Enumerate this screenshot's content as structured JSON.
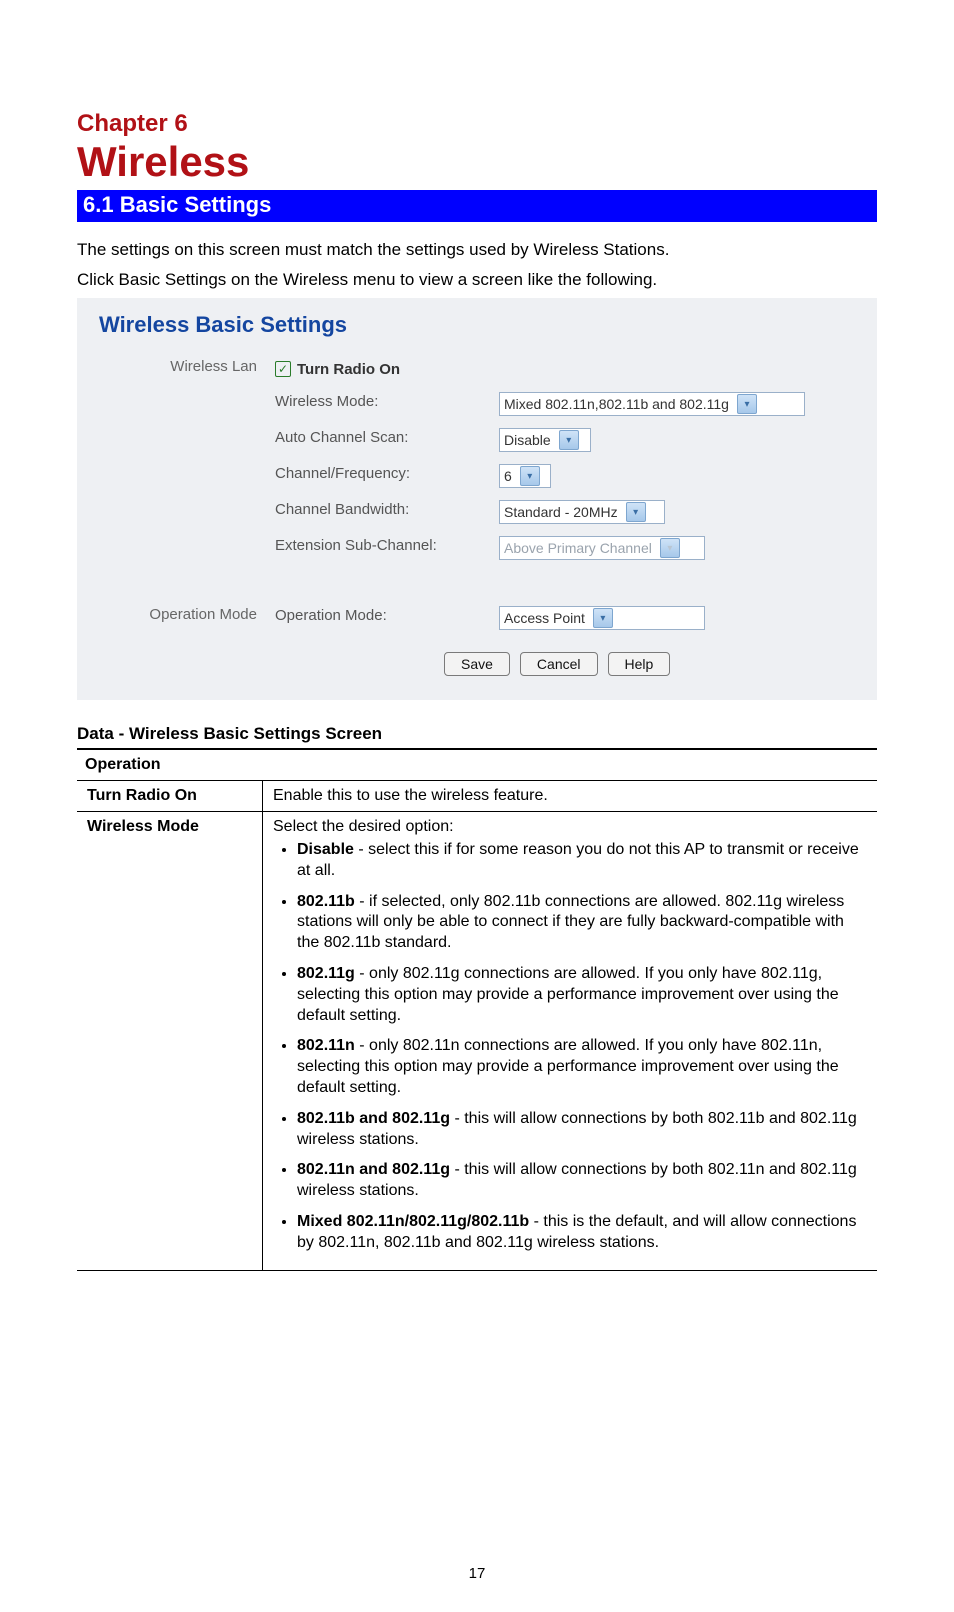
{
  "chapter_label": "Chapter 6",
  "chapter_title": "Wireless",
  "section_heading": "6.1 Basic Settings",
  "intro": {
    "line1": "The settings on this screen must match the settings used by Wireless Stations.",
    "line2": "Click Basic Settings on the Wireless menu to view a screen like the following."
  },
  "panel": {
    "title": "Wireless Basic Settings",
    "group1_label": "Wireless Lan",
    "turn_radio_on_label": "Turn Radio On",
    "turn_radio_on_checked": true,
    "fields": {
      "wireless_mode": {
        "label": "Wireless Mode:",
        "value": "Mixed 802.11n,802.11b and 802.11g"
      },
      "auto_channel_scan": {
        "label": "Auto Channel Scan:",
        "value": "Disable"
      },
      "channel_frequency": {
        "label": "Channel/Frequency:",
        "value": "6"
      },
      "channel_bandwidth": {
        "label": "Channel Bandwidth:",
        "value": "Standard - 20MHz"
      },
      "extension_sub_channel": {
        "label": "Extension Sub-Channel:",
        "value": "Above Primary Channel",
        "disabled": true
      }
    },
    "group2_label": "Operation Mode",
    "operation_mode": {
      "label": "Operation Mode:",
      "value": "Access Point"
    },
    "buttons": {
      "save": "Save",
      "cancel": "Cancel",
      "help": "Help"
    }
  },
  "data_heading": "Data - Wireless Basic Settings Screen",
  "table": {
    "section_header": "Operation",
    "rows": [
      {
        "name": "Turn Radio On",
        "desc_intro": "Enable this to use the wireless feature.",
        "bullets": []
      },
      {
        "name": "Wireless Mode",
        "desc_intro": "Select the desired option:",
        "bullets": [
          {
            "term": "Disable",
            "text": " - select this if for some reason you do not this AP to transmit or receive at all."
          },
          {
            "term": "802.11b",
            "text": " - if selected, only 802.11b connections are allowed. 802.11g wireless stations will only be able to connect if they are fully backward-compatible with the 802.11b standard."
          },
          {
            "term": "802.11g",
            "text": " - only 802.11g connections are allowed. If you only have 802.11g, selecting this option may provide a performance improvement over using the default setting."
          },
          {
            "term": "802.11n",
            "text": " - only 802.11n connections are allowed. If you only have 802.11n, selecting this option may provide a performance improvement over using the default setting."
          },
          {
            "term": "802.11b and 802.11g",
            "text": " - this will allow connections by both 802.11b and 802.11g wireless stations."
          },
          {
            "term": "802.11n and 802.11g",
            "text": " - this will allow connections by both 802.11n and 802.11g wireless stations."
          },
          {
            "term": "Mixed 802.11n/802.11g/802.11b",
            "text": " - this is the default, and will allow connections by 802.11n, 802.11b and 802.11g wireless stations."
          }
        ]
      }
    ]
  },
  "page_number": "17"
}
